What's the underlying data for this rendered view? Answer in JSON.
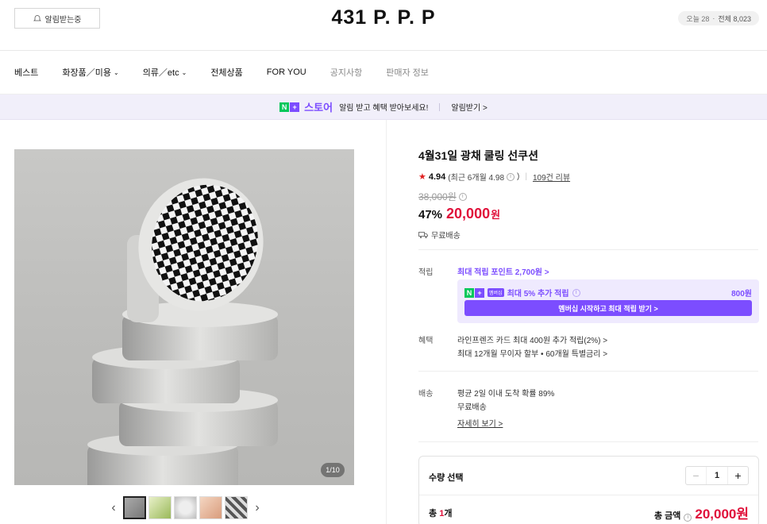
{
  "header": {
    "notify_label": "알림받는중",
    "store_name": "431 P. P. P",
    "visits_today": "오늘 28",
    "visits_total": "전체 8,023"
  },
  "nav": {
    "items": [
      {
        "label": "베스트"
      },
      {
        "label": "화장품／미용"
      },
      {
        "label": "의류／etc"
      },
      {
        "label": "전체상품"
      },
      {
        "label": "FOR YOU"
      },
      {
        "label": "공지사항"
      },
      {
        "label": "판매자 정보"
      }
    ]
  },
  "banner": {
    "store_word": "스토어",
    "message": "알림 받고 혜택 받아보세요!",
    "action": "알림받기 >"
  },
  "gallery": {
    "counter": "1/10",
    "prev_arrow": "‹",
    "next_arrow": "›"
  },
  "product": {
    "title": "4월31일 광채 쿨링 선쿠션",
    "rating": "4.94",
    "rating_recent": "(최근 6개월 4.98",
    "rating_recent_close": ")",
    "review_count": "109건 리뷰",
    "original_price": "38,000원",
    "discount": "47%",
    "price": "20,000",
    "price_unit": "원",
    "shipping": "무료배송"
  },
  "benefits": {
    "points_label": "적립",
    "points_link": "최대 적립 포인트 2,700원 >",
    "membership_tag": "멤버십",
    "membership_text": "최대 5% 추가 적립",
    "membership_amount": "800원",
    "membership_button": "멤버십 시작하고 최대 적립 받기 >",
    "perk_label": "혜택",
    "perk_line1": "라인프렌즈 카드 최대 400원 추가 적립(2%) >",
    "perk_line2": "최대 12개월 무이자 할부 • 60개월 특별금리 >",
    "delivery_label": "배송",
    "delivery_line1": "평균 2일 이내 도착 확률 89%",
    "delivery_line2": "무료배송",
    "detail_link": "자세히 보기 >"
  },
  "order": {
    "qty_label": "수량 선택",
    "qty_value": "1",
    "total_count_prefix": "총 ",
    "total_count_num": "1",
    "total_count_suffix": "개",
    "total_label": "총 금액",
    "total_price": "20,000원"
  },
  "colors": {
    "accent_purple": "#7c4dff",
    "price_red": "#e0103a",
    "naver_green": "#03c75a",
    "banner_bg": "#f1effa"
  }
}
